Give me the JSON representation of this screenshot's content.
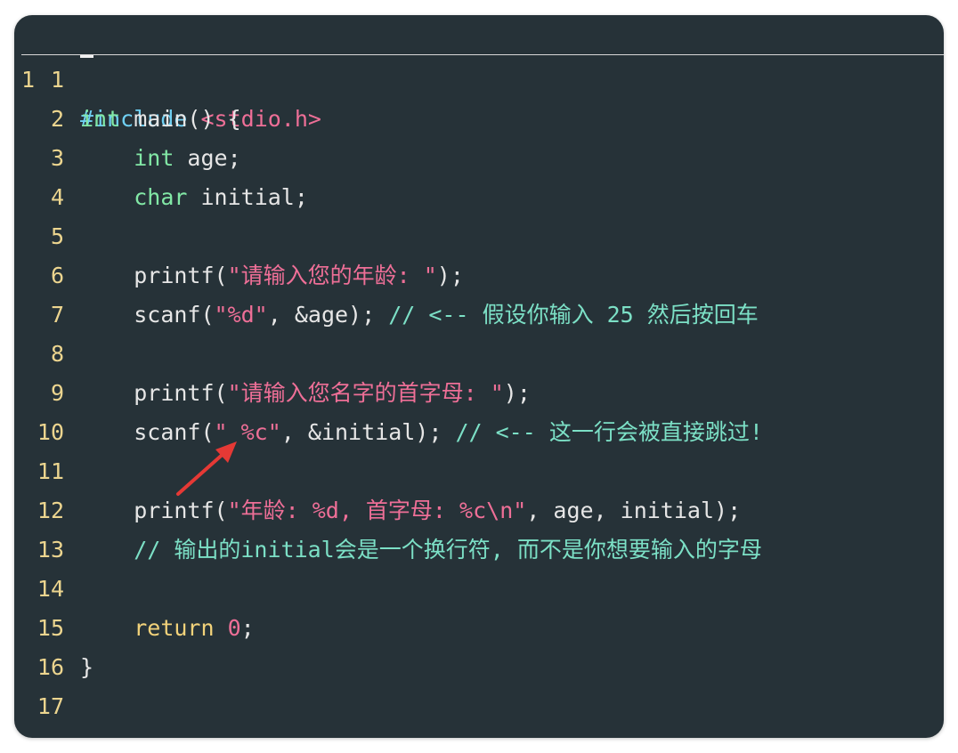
{
  "editor": {
    "header_line": {
      "number": "1",
      "directive": "#include",
      "header": "<stdio.h>"
    },
    "lines": [
      {
        "n": "1"
      },
      {
        "n": "2",
        "kw": "int",
        "rest": " main() {"
      },
      {
        "n": "3",
        "indent": "    ",
        "kw": "int",
        "rest": " age;"
      },
      {
        "n": "4",
        "indent": "    ",
        "kw": "char",
        "rest": " initial;"
      },
      {
        "n": "5"
      },
      {
        "n": "6",
        "indent": "    ",
        "pre": "printf(",
        "str": "\"请输入您的年龄: \"",
        "rest": ");"
      },
      {
        "n": "7",
        "indent": "    ",
        "pre": "scanf(",
        "str": "\"%d\"",
        "rest": ", &age); ",
        "cmt": "// <-- 假设你输入 25 然后按回车"
      },
      {
        "n": "8"
      },
      {
        "n": "9",
        "indent": "    ",
        "pre": "printf(",
        "str": "\"请输入您名字的首字母: \"",
        "rest": ");"
      },
      {
        "n": "10",
        "indent": "    ",
        "pre": "scanf(",
        "str": "\" %c\"",
        "rest": ", &initial); ",
        "cmt": "// <-- 这一行会被直接跳过!"
      },
      {
        "n": "11"
      },
      {
        "n": "12",
        "indent": "    ",
        "pre": "printf(",
        "str": "\"年龄: %d, 首字母: %c\\n\"",
        "rest": ", age, initial);"
      },
      {
        "n": "13",
        "indent": "    ",
        "cmt": "// 输出的initial会是一个换行符, 而不是你想要输入的字母"
      },
      {
        "n": "14"
      },
      {
        "n": "15",
        "indent": "    ",
        "ret": "return",
        "rest": " ",
        "num": "0",
        "rest2": ";"
      },
      {
        "n": "16",
        "rest": "}"
      },
      {
        "n": "17"
      }
    ]
  },
  "colors": {
    "background": "#263238",
    "keyword": "#82e8a6",
    "string": "#ee6f97",
    "comment": "#7ce0c6",
    "line_number": "#ecd58f",
    "arrow": "#e53935"
  }
}
